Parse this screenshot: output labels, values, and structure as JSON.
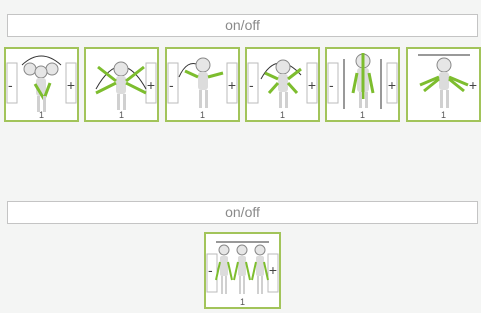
{
  "top_toggle": {
    "label": "on/off"
  },
  "bottom_toggle": {
    "label": "on/off"
  },
  "row1": [
    {
      "icon": "head-tilt-exercise-icon",
      "index": "1"
    },
    {
      "icon": "arm-swing-exercise-icon",
      "index": "1"
    },
    {
      "icon": "side-reach-exercise-icon",
      "index": "1"
    },
    {
      "icon": "arm-curl-exercise-icon",
      "index": "1"
    },
    {
      "icon": "torso-stretch-exercise-icon",
      "index": "1"
    },
    {
      "icon": "arm-raise-exercise-icon",
      "index": "1"
    }
  ],
  "row2": [
    {
      "icon": "group-stretch-exercise-icon",
      "index": "1"
    }
  ],
  "symbols": {
    "minus": "-",
    "plus": "+"
  },
  "colors": {
    "accent": "#a2c45a",
    "highlight": "#7dbd2e",
    "figure": "#d7d7d7"
  }
}
